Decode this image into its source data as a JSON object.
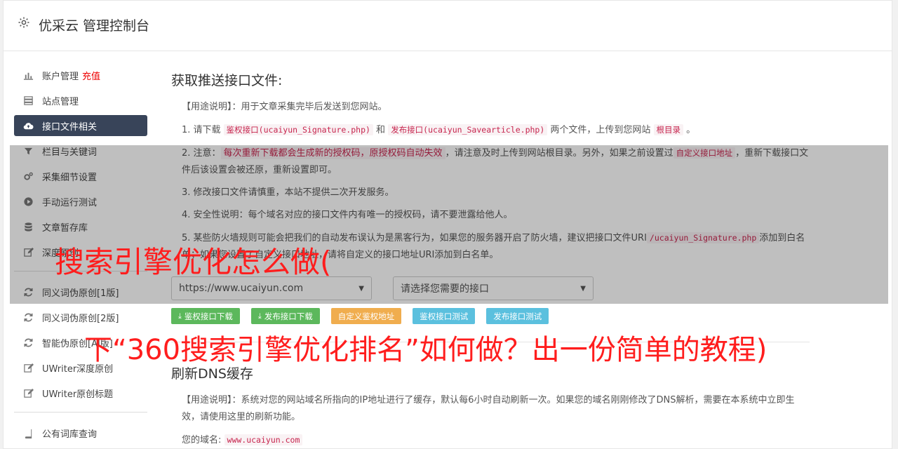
{
  "header": {
    "title": "优采云 管理控制台",
    "icon": "gear-icon"
  },
  "sidebar": {
    "items": [
      {
        "label": "账户管理",
        "extra": "充值",
        "icon": "bar-chart-icon"
      },
      {
        "label": "站点管理",
        "icon": "server-icon"
      },
      {
        "label": "接口文件相关",
        "icon": "cloud-upload-icon",
        "active": true
      },
      {
        "label": "栏目与关键词",
        "icon": "filter-icon"
      },
      {
        "label": "采集细节设置",
        "icon": "cogs-icon"
      },
      {
        "label": "手动运行测试",
        "icon": "play-circle-icon"
      },
      {
        "label": "文章暂存库",
        "icon": "database-icon"
      },
      {
        "label": "深度原创",
        "icon": "edit-icon"
      }
    ],
    "items2": [
      {
        "label": "同义词伪原创[1版]",
        "icon": "refresh-icon"
      },
      {
        "label": "同义词伪原创[2版]",
        "icon": "refresh-icon"
      },
      {
        "label": "智能伪原创[AI版]",
        "icon": "refresh-icon"
      },
      {
        "label": "UWriter深度原创",
        "icon": "edit-icon"
      },
      {
        "label": "UWriter原创标题",
        "icon": "edit-icon"
      }
    ],
    "items3": [
      {
        "label": "公有词库查询",
        "icon": "book-icon"
      }
    ]
  },
  "main": {
    "heading": "获取推送接口文件:",
    "usage_label": "【用途说明】",
    "usage_text": "：用于文章采集完毕后发送到您网站。",
    "p1_a": "1. 请下载 ",
    "p1_code1": "鉴权接口(ucaiyun_Signature.php)",
    "p1_b": " 和 ",
    "p1_code2": "发布接口(ucaiyun_Savearticle.php)",
    "p1_c": " 两个文件，上传到您网站 ",
    "p1_code3": "根目录",
    "p1_d": " 。",
    "p2_a": "2. 注意：",
    "p2_red": "每次重新下载都会生成新的授权码，原授权码自动失效",
    "p2_b": "，请注意及时上传到网站根目录。另外，如果之前设置过",
    "p2_code": "自定义接口地址",
    "p2_c": "，重新下载接口文件后该设置会被还原，重新设置即可。",
    "p3": "3. 修改接口文件请慎重，本站不提供二次开发服务。",
    "p4": "4. 安全性说明：每个域名对应的接口文件内有唯一的授权码，请不要泄露给他人。",
    "p5_a": "5. 某些防火墙规则可能会把我们的自动发布误认为是黑客行为，如果您的服务器开启了防火墙，建议把接口文件URI",
    "p5_code": "/ucaiyun_Signature.php",
    "p5_b": "添加到白名单；如果您设置了自定义接口地址，请将自定义的接口地址URI添加到白名单。",
    "select1_value": "https://www.ucaiyun.com",
    "select2_placeholder": "请选择您需要的接口",
    "buttons": [
      {
        "label": "鉴权接口下载",
        "color": "#5cb85c"
      },
      {
        "label": "发布接口下载",
        "color": "#5cb85c"
      },
      {
        "label": "自定义鉴权地址",
        "color": "#f0ad4e"
      },
      {
        "label": "鉴权接口测试",
        "color": "#5bc0de"
      },
      {
        "label": "发布接口测试",
        "color": "#5bc0de"
      }
    ]
  },
  "dns": {
    "heading": "刷新DNS缓存",
    "usage_label": "【用途说明】",
    "usage_text": "：系统对您的网站域名所指向的IP地址进行了缓存，默认每6小时自动刷新一次。如果您的域名刚刚修改了DNS解析，需要在本系统中立即生效，请使用这里的刷新功能。",
    "domain_label": "您的域名: ",
    "domain_value": "www.ucaiyun.com"
  },
  "overlay": {
    "line1": "搜索引擎优化怎么做(",
    "line2": "下“360搜索引擎优化排名”如何做？出一份简单的教程)"
  }
}
